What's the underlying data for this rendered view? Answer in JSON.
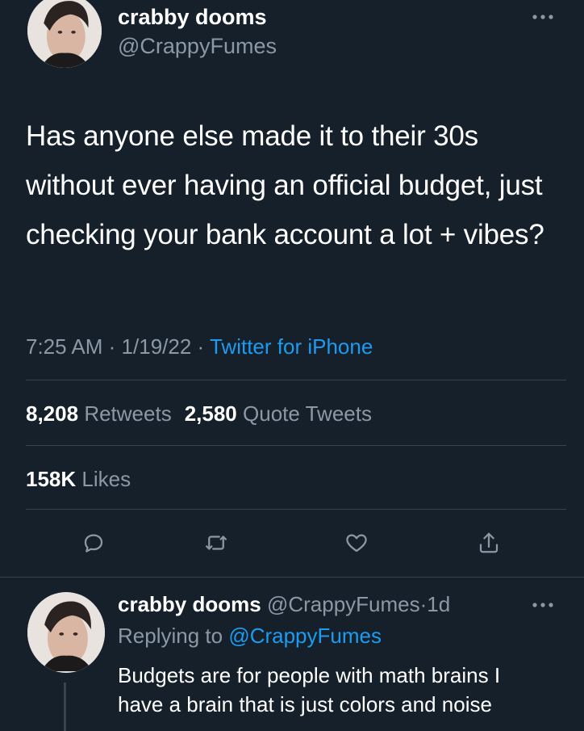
{
  "tweet": {
    "author": {
      "name": "crabby dooms",
      "handle": "@CrappyFumes",
      "avatar_icon": "profile-photo"
    },
    "more_icon": "more-horizontal-icon",
    "text": "Has anyone else made it to their 30s without ever having an official budget, just checking your bank account a lot + vibes?",
    "time": "7:25 AM",
    "date": "1/19/22",
    "separator": "·",
    "source": "Twitter for iPhone",
    "retweets": {
      "count": "8,208",
      "label": "Retweets"
    },
    "quote_tweets": {
      "count": "2,580",
      "label": "Quote Tweets"
    },
    "likes": {
      "count": "158K",
      "label": "Likes"
    },
    "actions": [
      {
        "name": "reply",
        "icon": "reply-icon"
      },
      {
        "name": "retweet",
        "icon": "retweet-icon"
      },
      {
        "name": "like",
        "icon": "heart-icon"
      },
      {
        "name": "share",
        "icon": "share-icon"
      }
    ]
  },
  "reply": {
    "author": {
      "name": "crabby dooms",
      "handle": "@CrappyFumes",
      "avatar_icon": "profile-photo"
    },
    "age": "1d",
    "separator": "·",
    "replying_prefix": "Replying to",
    "replying_to": "@CrappyFumes",
    "text_line1": "Budgets are for people with math brains I",
    "text_line2": "have a brain that is just colors and noise"
  },
  "colors": {
    "background": "#15202b",
    "text": "#ffffff",
    "secondary": "#8b98a5",
    "link": "#1d9bf0",
    "divider": "#38444d"
  }
}
